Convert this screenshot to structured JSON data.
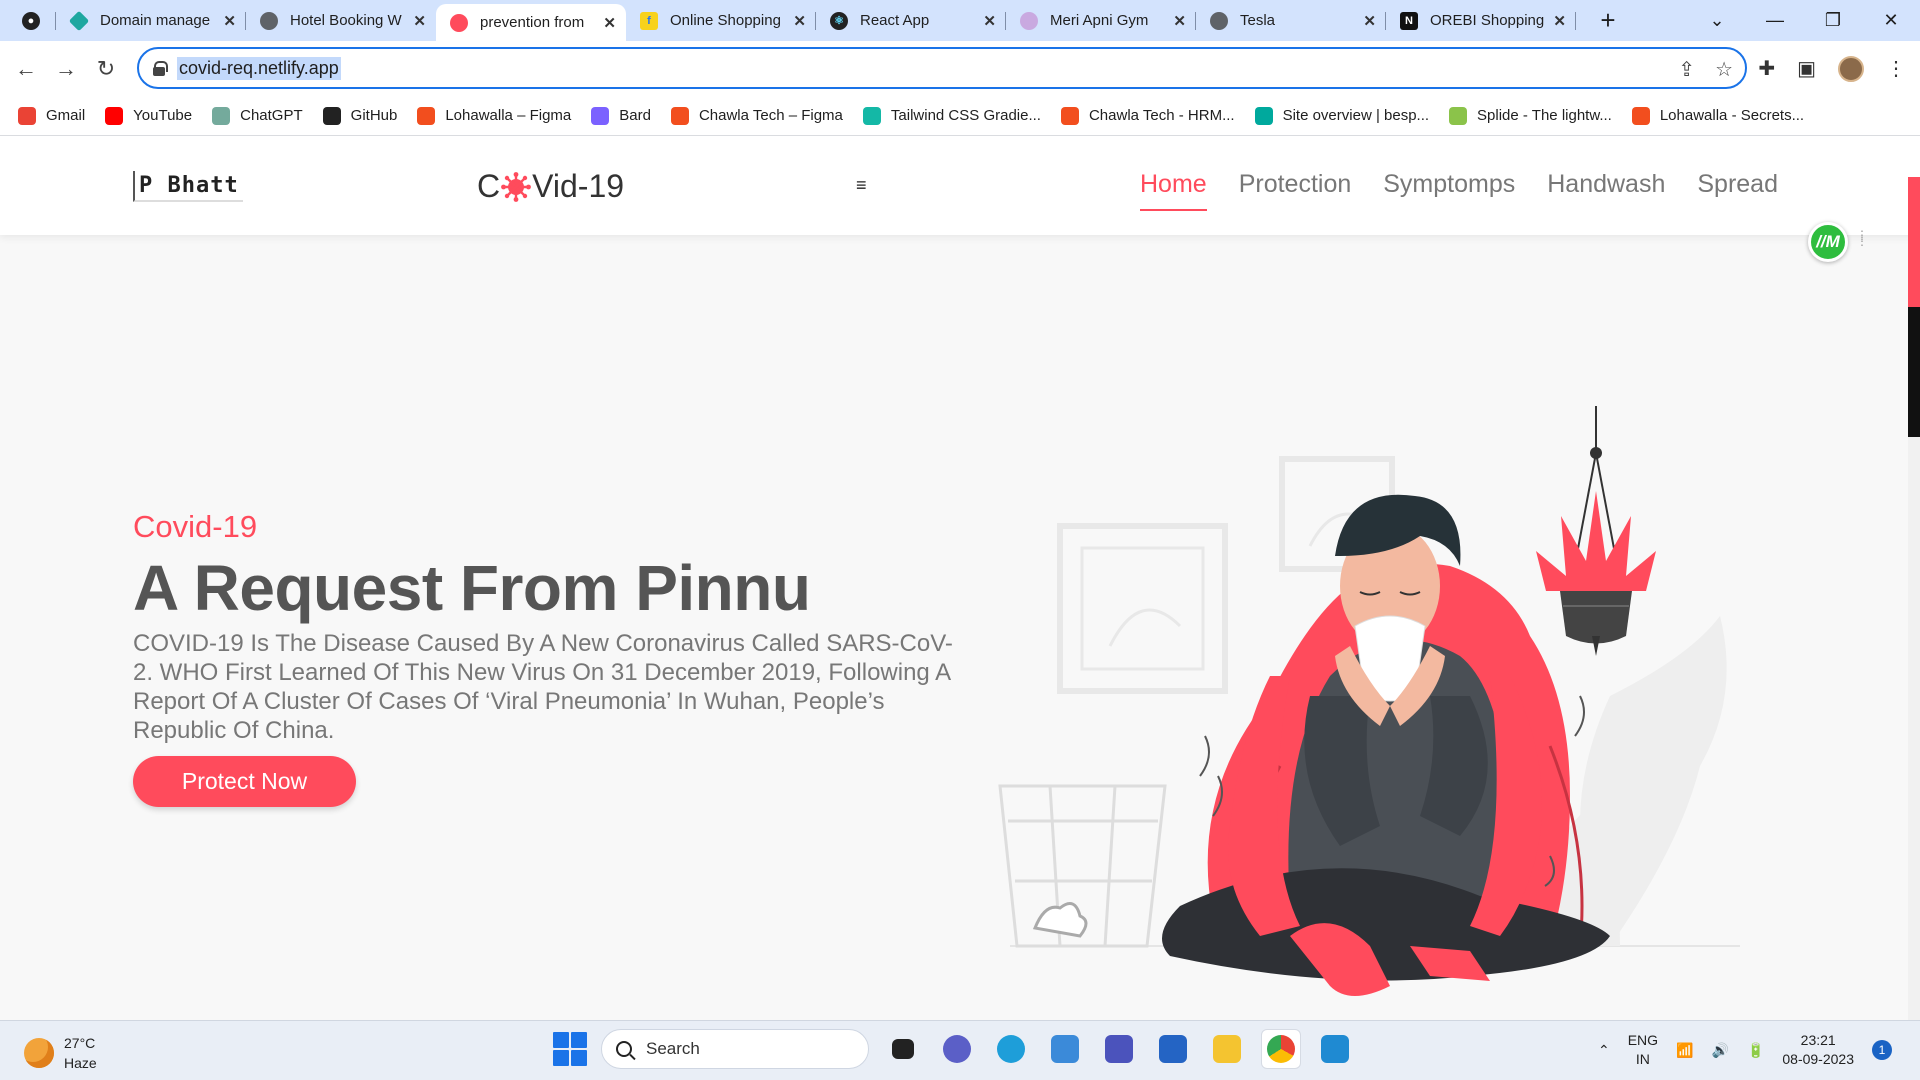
{
  "browser": {
    "tabs": [
      {
        "title": "",
        "icon": "github-icon"
      },
      {
        "title": "Domain manage",
        "icon": "netlify-icon"
      },
      {
        "title": "Hotel Booking W",
        "icon": "globe-icon"
      },
      {
        "title": "prevention from",
        "icon": "virus-icon"
      },
      {
        "title": "Online Shopping",
        "icon": "flipkart-icon"
      },
      {
        "title": "React App",
        "icon": "react-icon"
      },
      {
        "title": "Meri Apni Gym",
        "icon": "gym-icon"
      },
      {
        "title": "Tesla",
        "icon": "globe-icon"
      },
      {
        "title": "OREBI Shopping",
        "icon": "orebi-icon"
      }
    ],
    "active_tab": 3,
    "url": "covid-req.netlify.app",
    "bookmarks": [
      {
        "label": "Gmail",
        "color": "#ea4335"
      },
      {
        "label": "YouTube",
        "color": "#ff0000"
      },
      {
        "label": "ChatGPT",
        "color": "#74aa9c"
      },
      {
        "label": "GitHub",
        "color": "#222222"
      },
      {
        "label": "Lohawalla – Figma",
        "color": "#f24e1e"
      },
      {
        "label": "Bard",
        "color": "#7b61ff"
      },
      {
        "label": "Chawla Tech – Figma",
        "color": "#f24e1e"
      },
      {
        "label": "Tailwind CSS Gradie...",
        "color": "#14b8a6"
      },
      {
        "label": "Chawla Tech - HRM...",
        "color": "#f24e1e"
      },
      {
        "label": "Site overview | besp...",
        "color": "#00a99d"
      },
      {
        "label": "Splide - The lightw...",
        "color": "#8bc34a"
      },
      {
        "label": "Lohawalla - Secrets...",
        "color": "#f24e1e"
      }
    ]
  },
  "site": {
    "brand": "P Bhatt",
    "logo_left": "C",
    "logo_right": "Vid-19",
    "menu_icon": "≡",
    "nav": [
      "Home",
      "Protection",
      "Symptomps",
      "Handwash",
      "Spread"
    ],
    "active_nav": "Home",
    "extension_badge": "//M",
    "hero": {
      "eyebrow": "Covid-19",
      "title": "A Request From Pinnu",
      "description": "COVID-19 Is The Disease Caused By A New Coronavirus Called SARS-CoV-2. WHO First Learned Of This New Virus On 31 December 2019, Following A Report Of A Cluster Of Cases Of ‘Viral Pneumonia’ In Wuhan, People’s Republic Of China.",
      "cta": "Protect Now"
    },
    "accent": "#ff4b5c"
  },
  "taskbar": {
    "weather": {
      "temp": "27°C",
      "condition": "Haze"
    },
    "search_placeholder": "Search",
    "lang": {
      "line1": "ENG",
      "line2": "IN"
    },
    "time": "23:21",
    "date": "08-09-2023",
    "notifications": "1"
  }
}
